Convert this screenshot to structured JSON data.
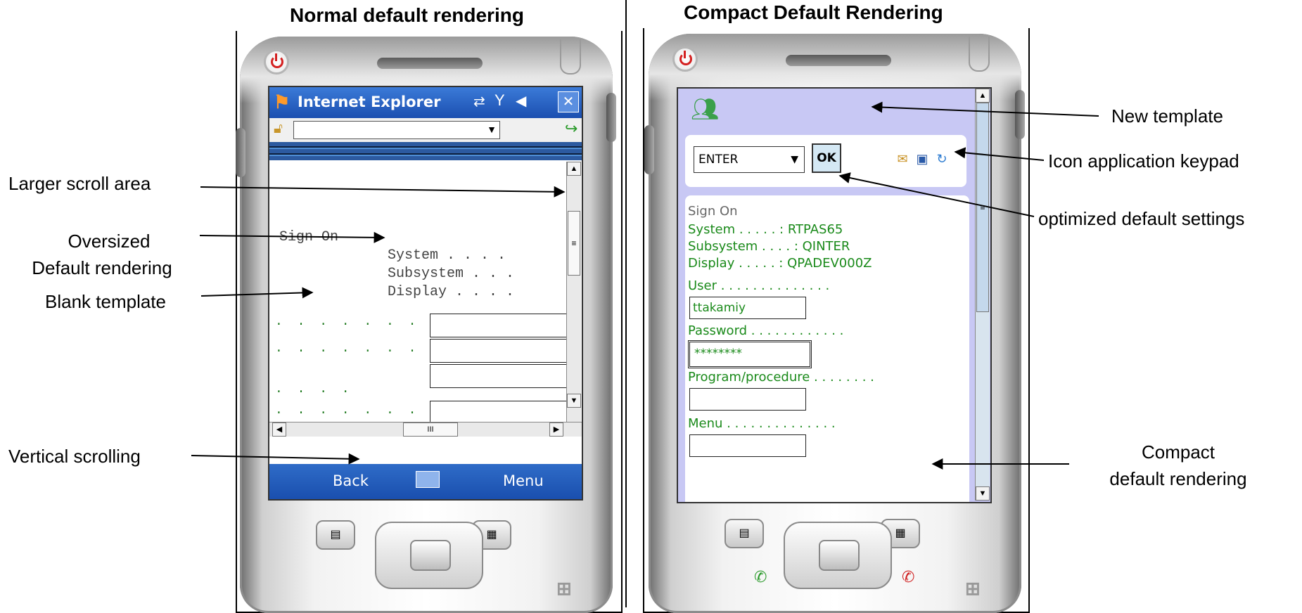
{
  "captions": {
    "left": "Normal default rendering",
    "right": "Compact Default Rendering"
  },
  "annotations": {
    "left": {
      "larger_scroll": "Larger scroll area",
      "oversized_line1": "Oversized",
      "oversized_line2": "Default rendering",
      "blank_template": "Blank template",
      "vertical_scrolling": "Vertical scrolling"
    },
    "right": {
      "new_template": "New template",
      "icon_keypad": "Icon application keypad",
      "optimized": "optimized default settings",
      "compact_line1": "Compact",
      "compact_line2": "default rendering"
    }
  },
  "left_device": {
    "browser_title": "Internet Explorer",
    "close_label": "✕",
    "sign_on": "Sign On",
    "system": "System . . . .",
    "subsystem": "Subsystem . . .",
    "display": "Display . . . .",
    "dot_rows": [
      ". . . . . . . . .",
      ". . . . . . . . .",
      ". . . .",
      ". . . . . . . . ."
    ],
    "softkeys": {
      "left": "Back",
      "right": "Menu"
    },
    "hscroll_thumb": "III",
    "vscroll_thumb": "≡"
  },
  "right_device": {
    "command": "ENTER",
    "ok": "OK",
    "sign_on": "Sign On",
    "system": "System . . . . . : RTPAS65",
    "subsystem": "Subsystem . . . . : QINTER",
    "display": "Display . . . . . : QPADEV000Z",
    "user_label": "User . . . . . . . . . . . . . .",
    "user_value": "ttakamiy",
    "password_label": "Password . . . . . . . . . . . .",
    "password_value": "********",
    "program_label": "Program/procedure . . . . . . . .",
    "program_value": "",
    "menu_label": "Menu . . . . . . . . . . . . . .",
    "menu_value": "",
    "vscroll_thumb": "≡"
  },
  "icons": {
    "power": "power-icon",
    "windows_start": "windows-flag-icon",
    "connectivity": "sync-icon",
    "signal": "signal-icon",
    "volume": "volume-icon",
    "lock": "lock-icon",
    "go": "go-arrow-icon",
    "keyboard": "keyboard-icon",
    "users": "users-icon",
    "message": "message-warning-icon",
    "keypad": "keypad-icon",
    "refresh": "refresh-icon",
    "call": "call-icon",
    "end_call": "end-call-icon"
  },
  "colors": {
    "ie_title": "#1b4fb0",
    "lavender": "#c8c8f4",
    "green_text": "#1a8a1a"
  }
}
